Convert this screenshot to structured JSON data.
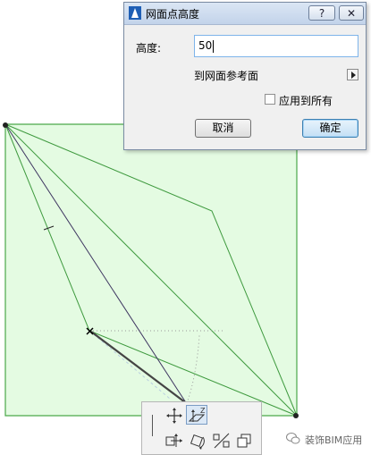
{
  "dialog": {
    "title": "网面点高度",
    "help_label": "?",
    "close_label": "✕",
    "height_label": "高度:",
    "height_value": "50",
    "reference_label": "到网面参考面",
    "apply_all_label": "应用到所有",
    "apply_all_checked": false,
    "cancel_label": "取消",
    "ok_label": "确定"
  },
  "toolbar": {
    "tools": [
      {
        "name": "move-icon"
      },
      {
        "name": "elevate-z-icon",
        "active": true
      },
      {
        "name": "offset-move-icon"
      },
      {
        "name": "rotate-icon"
      },
      {
        "name": "mirror-icon"
      },
      {
        "name": "copy-icon"
      }
    ]
  },
  "watermark": {
    "text": "装饰BIM应用"
  },
  "colors": {
    "mesh_fill": "#e4fbe2",
    "mesh_stroke": "#4aa84a",
    "accent": "#3c7fb1"
  }
}
